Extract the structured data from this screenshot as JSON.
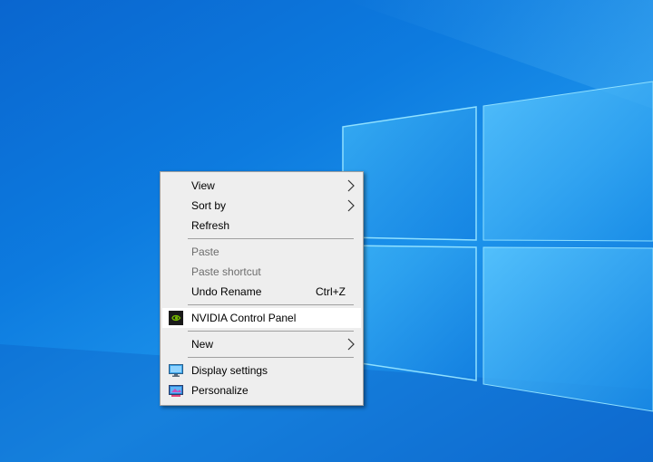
{
  "desktop": {
    "background_color": "#0d7bdf",
    "accent_light": "#4fc3ff"
  },
  "context_menu": {
    "group_view": [
      {
        "label": "View",
        "has_submenu": true
      },
      {
        "label": "Sort by",
        "has_submenu": true
      },
      {
        "label": "Refresh",
        "has_submenu": false
      }
    ],
    "group_edit": [
      {
        "label": "Paste",
        "disabled": true
      },
      {
        "label": "Paste shortcut",
        "disabled": true
      },
      {
        "label": "Undo Rename",
        "shortcut": "Ctrl+Z",
        "disabled": false
      }
    ],
    "nvidia": {
      "label": "NVIDIA Control Panel",
      "icon": "nvidia-icon",
      "highlighted": true
    },
    "new": {
      "label": "New",
      "has_submenu": true
    },
    "group_settings": [
      {
        "label": "Display settings",
        "icon": "display-settings-icon"
      },
      {
        "label": "Personalize",
        "icon": "personalize-icon"
      }
    ]
  }
}
